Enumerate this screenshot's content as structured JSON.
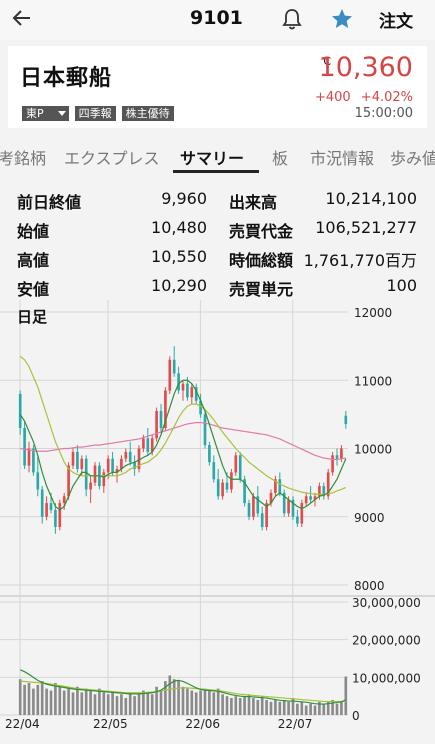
{
  "topbar": {
    "code": "9101",
    "order_label": "注文"
  },
  "stock": {
    "name": "日本郵船",
    "market_badge": "東P",
    "badges": [
      "四季報",
      "株主優待"
    ],
    "price_mark": "C",
    "price": "10,360",
    "change": "+400 +4.02%",
    "time": "15:00:00"
  },
  "tabs": [
    "考銘柄",
    "エクスプレス",
    "サマリー",
    "板",
    "市況情報",
    "歩み値"
  ],
  "active_tab": "サマリー",
  "stats": {
    "left": [
      {
        "label": "前日終値",
        "value": "9,960"
      },
      {
        "label": "始値",
        "value": "10,480"
      },
      {
        "label": "高値",
        "value": "10,550"
      },
      {
        "label": "安値",
        "value": "10,290"
      }
    ],
    "right": [
      {
        "label": "出来高",
        "value": "10,214,100"
      },
      {
        "label": "売買代金",
        "value": "106,521,277"
      },
      {
        "label": "時価総額",
        "value": "1,761,770百万"
      },
      {
        "label": "売買単元",
        "value": "100"
      }
    ]
  },
  "chart_data": {
    "type": "candlestick",
    "label": "日足",
    "price_ticks": [
      "12000",
      "11000",
      "10000",
      "9000",
      "8000"
    ],
    "price_range": [
      8000,
      12000
    ],
    "volume_ticks": [
      "30,000,000",
      "20,000,000",
      "10,000,000",
      "0"
    ],
    "volume_range": [
      0,
      30000000
    ],
    "date_labels": [
      "22/04",
      "22/05",
      "22/06",
      "22/07"
    ],
    "colors": {
      "up": "#e34a4a",
      "down": "#2aa8a8",
      "ma_short": "#2f8f3a",
      "ma_mid": "#a8c23a",
      "ma_long": "#e07aa8"
    },
    "candles": [
      [
        10800,
        10850,
        10200,
        10300
      ],
      [
        10300,
        10400,
        9700,
        9750
      ],
      [
        9750,
        10100,
        9650,
        10000
      ],
      [
        10000,
        10050,
        9600,
        9650
      ],
      [
        9650,
        9900,
        9300,
        9400
      ],
      [
        9400,
        9450,
        8900,
        9000
      ],
      [
        9000,
        9300,
        8950,
        9200
      ],
      [
        9200,
        9350,
        9050,
        9100
      ],
      [
        9100,
        9200,
        8750,
        8850
      ],
      [
        8850,
        9250,
        8800,
        9200
      ],
      [
        9200,
        9350,
        9100,
        9300
      ],
      [
        9300,
        9800,
        9250,
        9750
      ],
      [
        9750,
        10000,
        9700,
        9950
      ],
      [
        9950,
        10050,
        9650,
        9700
      ],
      [
        9700,
        9900,
        9600,
        9850
      ],
      [
        9850,
        9900,
        9300,
        9400
      ],
      [
        9400,
        9600,
        9200,
        9500
      ],
      [
        9500,
        9800,
        9450,
        9750
      ],
      [
        9750,
        9800,
        9400,
        9450
      ],
      [
        9450,
        9700,
        9350,
        9650
      ],
      [
        9650,
        9900,
        9550,
        9850
      ],
      [
        9850,
        9950,
        9600,
        9650
      ],
      [
        9650,
        9750,
        9500,
        9700
      ],
      [
        9700,
        9900,
        9650,
        9850
      ],
      [
        9850,
        10000,
        9800,
        9950
      ],
      [
        9950,
        10100,
        9750,
        9800
      ],
      [
        9800,
        9900,
        9600,
        9700
      ],
      [
        9700,
        10050,
        9650,
        10000
      ],
      [
        10000,
        10200,
        9950,
        10150
      ],
      [
        10150,
        10300,
        9900,
        9950
      ],
      [
        9950,
        10200,
        9900,
        10150
      ],
      [
        10150,
        10600,
        10100,
        10550
      ],
      [
        10550,
        10650,
        10250,
        10300
      ],
      [
        10300,
        10900,
        10250,
        10850
      ],
      [
        10850,
        11350,
        10800,
        11300
      ],
      [
        11300,
        11500,
        11050,
        11100
      ],
      [
        11100,
        11200,
        10800,
        10850
      ],
      [
        10850,
        11000,
        10700,
        10950
      ],
      [
        10950,
        11050,
        10700,
        10750
      ],
      [
        10750,
        10950,
        10650,
        10900
      ],
      [
        10900,
        10950,
        10650,
        10700
      ],
      [
        10700,
        10800,
        10450,
        10500
      ],
      [
        10500,
        10550,
        10000,
        10050
      ],
      [
        10050,
        10100,
        9750,
        9800
      ],
      [
        9800,
        9900,
        9500,
        9550
      ],
      [
        9550,
        9700,
        9250,
        9300
      ],
      [
        9300,
        9550,
        9250,
        9500
      ],
      [
        9500,
        9650,
        9350,
        9400
      ],
      [
        9400,
        9700,
        9350,
        9650
      ],
      [
        9650,
        9950,
        9600,
        9900
      ],
      [
        9900,
        9950,
        9500,
        9550
      ],
      [
        9550,
        9600,
        9150,
        9200
      ],
      [
        9200,
        9250,
        8950,
        9000
      ],
      [
        9000,
        9350,
        8950,
        9300
      ],
      [
        9300,
        9450,
        9000,
        9050
      ],
      [
        9050,
        9150,
        8800,
        8850
      ],
      [
        8850,
        9250,
        8800,
        9200
      ],
      [
        9200,
        9400,
        9150,
        9350
      ],
      [
        9350,
        9600,
        9300,
        9550
      ],
      [
        9550,
        9650,
        9300,
        9350
      ],
      [
        9350,
        9400,
        9000,
        9050
      ],
      [
        9050,
        9300,
        9000,
        9250
      ],
      [
        9250,
        9300,
        8950,
        9000
      ],
      [
        9000,
        9100,
        8850,
        8900
      ],
      [
        8900,
        9250,
        8850,
        9200
      ],
      [
        9200,
        9350,
        9150,
        9300
      ],
      [
        9300,
        9450,
        9200,
        9250
      ],
      [
        9250,
        9350,
        9150,
        9300
      ],
      [
        9300,
        9500,
        9250,
        9450
      ],
      [
        9450,
        9500,
        9250,
        9300
      ],
      [
        9300,
        9700,
        9250,
        9650
      ],
      [
        9650,
        9950,
        9600,
        9900
      ],
      [
        9900,
        10000,
        9750,
        9850
      ],
      [
        9850,
        10050,
        9800,
        10000
      ],
      [
        10480,
        10550,
        10290,
        10360
      ]
    ],
    "volumes": [
      9500000,
      8000000,
      8500000,
      7000000,
      8000000,
      9000000,
      7000000,
      6500000,
      8500000,
      7500000,
      6500000,
      7000000,
      6000000,
      7500000,
      6000000,
      7000000,
      6500000,
      5500000,
      7000000,
      6000000,
      5500000,
      6000000,
      5000000,
      5500000,
      4500000,
      6000000,
      5000000,
      5500000,
      6500000,
      6000000,
      5500000,
      7500000,
      6500000,
      9000000,
      10500000,
      9500000,
      9000000,
      7500000,
      7000000,
      6500000,
      6000000,
      6500000,
      7000000,
      6500000,
      6000000,
      7000000,
      5500000,
      5000000,
      4500000,
      5000000,
      4500000,
      5000000,
      5500000,
      4500000,
      4000000,
      5000000,
      4000000,
      3500000,
      4000000,
      3500000,
      4000000,
      3500000,
      4500000,
      3000000,
      3500000,
      2500000,
      3000000,
      2500000,
      3500000,
      3000000,
      3500000,
      4000000,
      3000000,
      3500000,
      10214100
    ],
    "ma_short": [
      10500,
      10400,
      10250,
      10100,
      9900,
      9650,
      9450,
      9300,
      9150,
      9100,
      9150,
      9300,
      9450,
      9550,
      9650,
      9650,
      9600,
      9600,
      9600,
      9580,
      9620,
      9650,
      9650,
      9700,
      9750,
      9780,
      9800,
      9830,
      9870,
      9900,
      9950,
      10050,
      10200,
      10400,
      10600,
      10800,
      10950,
      11000,
      11000,
      10950,
      10850,
      10700,
      10550,
      10350,
      10150,
      9950,
      9750,
      9600,
      9550,
      9550,
      9550,
      9500,
      9400,
      9300,
      9250,
      9200,
      9150,
      9200,
      9300,
      9350,
      9300,
      9250,
      9200,
      9150,
      9120,
      9150,
      9200,
      9250,
      9300,
      9320,
      9350,
      9450,
      9550,
      9700,
      9850
    ],
    "ma_mid": [
      11350,
      11300,
      11200,
      11050,
      10900,
      10700,
      10500,
      10300,
      10100,
      9950,
      9800,
      9700,
      9650,
      9620,
      9600,
      9600,
      9600,
      9600,
      9600,
      9600,
      9600,
      9600,
      9600,
      9620,
      9650,
      9700,
      9720,
      9750,
      9780,
      9800,
      9850,
      9900,
      9980,
      10080,
      10200,
      10320,
      10450,
      10550,
      10620,
      10650,
      10650,
      10620,
      10570,
      10500,
      10420,
      10330,
      10240,
      10160,
      10080,
      10000,
      9930,
      9870,
      9800,
      9750,
      9700,
      9650,
      9600,
      9560,
      9520,
      9480,
      9450,
      9420,
      9400,
      9380,
      9360,
      9350,
      9340,
      9330,
      9330,
      9330,
      9340,
      9350,
      9380,
      9400,
      9430
    ],
    "ma_long": [
      10000,
      9990,
      9980,
      9970,
      9960,
      9960,
      9960,
      9970,
      9980,
      9990,
      10000,
      10000,
      10010,
      10020,
      10020,
      10030,
      10040,
      10050,
      10050,
      10060,
      10070,
      10080,
      10090,
      10100,
      10110,
      10120,
      10130,
      10140,
      10160,
      10180,
      10200,
      10220,
      10240,
      10260,
      10280,
      10300,
      10320,
      10340,
      10360,
      10370,
      10380,
      10380,
      10370,
      10360,
      10340,
      10320,
      10300,
      10290,
      10280,
      10270,
      10260,
      10250,
      10240,
      10230,
      10220,
      10210,
      10200,
      10180,
      10160,
      10140,
      10110,
      10080,
      10050,
      10020,
      9990,
      9960,
      9930,
      9900,
      9880,
      9860,
      9850,
      9840,
      9840,
      9850,
      9860
    ],
    "vol_ma_short": [
      12000000,
      11500000,
      10800000,
      10000000,
      9200000,
      8600000,
      8200000,
      7900000,
      7700000,
      7500000,
      7300000,
      7100000,
      6900000,
      6800000,
      6700000,
      6600000,
      6500000,
      6400000,
      6300000,
      6200000,
      6100000,
      6000000,
      5900000,
      5800000,
      5700000,
      5600000,
      5600000,
      5600000,
      5700000,
      5800000,
      5900000,
      6200000,
      6600000,
      7400000,
      8300000,
      9000000,
      9200000,
      8900000,
      8400000,
      7800000,
      7200000,
      6800000,
      6600000,
      6500000,
      6400000,
      6300000,
      6000000,
      5700000,
      5400000,
      5200000,
      5000000,
      4900000,
      4900000,
      4800000,
      4700000,
      4600000,
      4500000,
      4300000,
      4100000,
      3900000,
      3800000,
      3700000,
      3700000,
      3600000,
      3500000,
      3400000,
      3200000,
      3000000,
      2900000,
      2900000,
      3000000,
      3200000,
      3300000,
      3500000,
      4000000
    ],
    "vol_ma_mid": [
      9000000,
      8900000,
      8800000,
      8700000,
      8600000,
      8500000,
      8400000,
      8200000,
      8000000,
      7800000,
      7600000,
      7400000,
      7200000,
      7000000,
      6900000,
      6800000,
      6700000,
      6600000,
      6500000,
      6400000,
      6300000,
      6200000,
      6100000,
      6000000,
      5900000,
      5900000,
      5900000,
      5900000,
      5900000,
      6000000,
      6100000,
      6200000,
      6400000,
      6600000,
      6800000,
      7000000,
      7100000,
      7200000,
      7200000,
      7100000,
      7000000,
      6900000,
      6800000,
      6700000,
      6600000,
      6500000,
      6300000,
      6100000,
      5900000,
      5700000,
      5500000,
      5400000,
      5300000,
      5200000,
      5100000,
      5000000,
      4900000,
      4800000,
      4700000,
      4600000,
      4500000,
      4400000,
      4300000,
      4200000,
      4100000,
      4000000,
      3900000,
      3800000,
      3700000,
      3600000,
      3600000,
      3600000,
      3600000,
      3600000,
      3700000
    ]
  }
}
